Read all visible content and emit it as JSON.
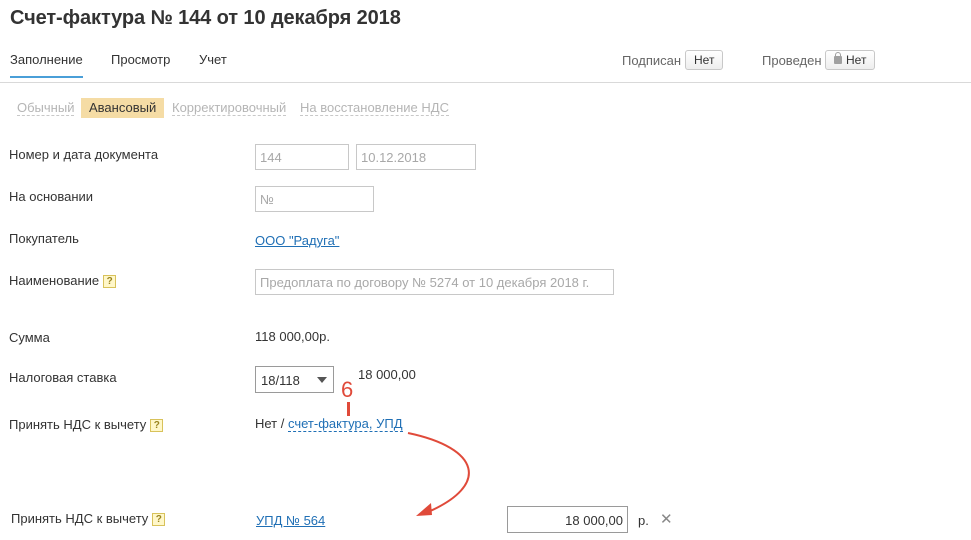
{
  "header": {
    "title": "Счет-фактура № 144 от 10 декабря 2018"
  },
  "tabs": [
    {
      "label": "Заполнение"
    },
    {
      "label": "Просмотр"
    },
    {
      "label": "Учет"
    }
  ],
  "status": {
    "signed_label": "Подписан",
    "signed_value": "Нет",
    "posted_label": "Проведен",
    "posted_value": "Нет"
  },
  "invoice_types": [
    {
      "label": "Обычный"
    },
    {
      "label": "Авансовый"
    },
    {
      "label": "Корректировочный"
    },
    {
      "label": "На восстановление НДС"
    }
  ],
  "form": {
    "doc_label": "Номер и дата документа",
    "doc_number": "144",
    "doc_date": "10.12.2018",
    "basis_label": "На основании",
    "basis_placeholder": "№",
    "buyer_label": "Покупатель",
    "buyer_value": "ООО \"Радуга\"",
    "name_label": "Наименование",
    "name_placeholder": "Предоплата по договору № 5274 от 10 декабря 2018 г.",
    "sum_label": "Сумма",
    "sum_value": "118 000,00р.",
    "tax_label": "Налоговая ставка",
    "tax_rate": "18/118",
    "tax_amount": "18 000,00",
    "vat_label": "Принять НДС к вычету",
    "vat_no": "Нет /",
    "vat_link": "счет-фактура, УПД",
    "vat2_label": "Принять НДС к вычету",
    "upd_link": "УПД № 564",
    "upd_amount": "18 000,00",
    "currency": "р.",
    "help_glyph": "?",
    "close_glyph": "✕"
  },
  "annotation": {
    "number": "6",
    "color": "#e04a3a"
  }
}
